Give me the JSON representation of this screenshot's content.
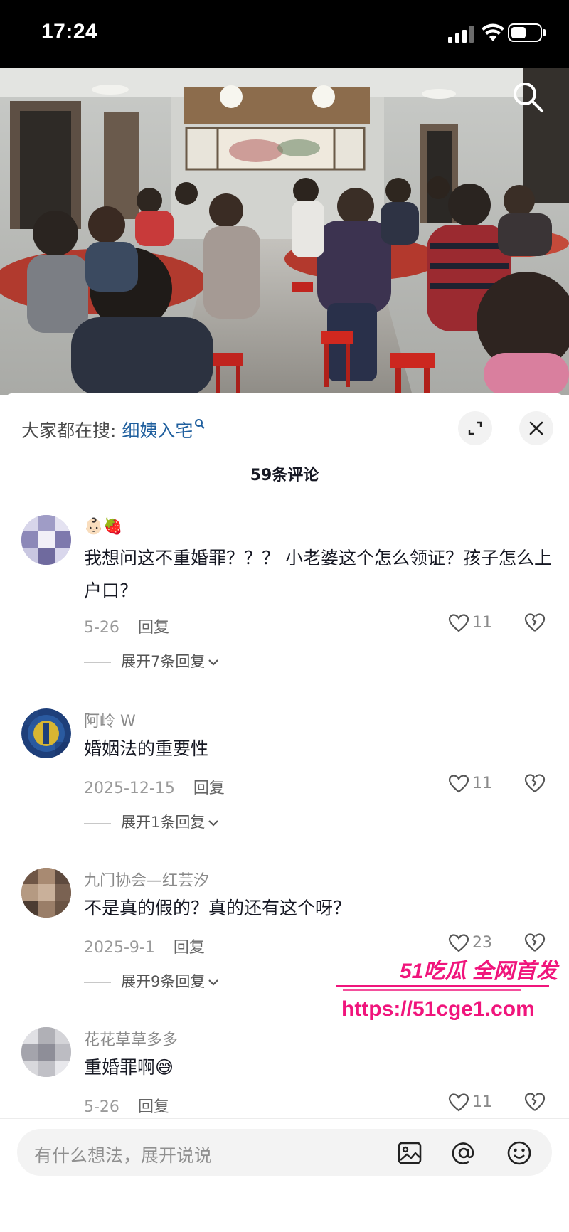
{
  "status_bar": {
    "time": "17:24"
  },
  "search_hint": {
    "label": "大家都在搜:",
    "term": "细姨入宅"
  },
  "comment_count": "59条评论",
  "comments": [
    {
      "username": "",
      "text": "我想问这不重婚罪？？？ 小老婆这个怎么领证？孩子怎么上户口？",
      "date": "5-26",
      "reply_label": "回复",
      "likes": "11",
      "expand_label": "展开7条回复"
    },
    {
      "username": "阿岭 W",
      "text": "婚姻法的重要性",
      "date": "2025-12-15",
      "reply_label": "回复",
      "likes": "11",
      "expand_label": "展开1条回复"
    },
    {
      "username": "九门协会—红芸汐",
      "text": "不是真的假的？真的还有这个呀？",
      "date": "2025-9-1",
      "reply_label": "回复",
      "likes": "23",
      "expand_label": "展开9条回复"
    },
    {
      "username": "花花草草多多",
      "text": "重婚罪啊😅",
      "date": "5-26",
      "reply_label": "回复",
      "likes": "11"
    }
  ],
  "watermark": {
    "brand": "51吃瓜 全网首发",
    "url": "https://51cge1.com"
  },
  "input_bar": {
    "placeholder": "有什么想法，展开说说"
  },
  "icons": {
    "search": "search-icon",
    "expand": "expand-icon",
    "close": "close-icon",
    "like": "heart-icon",
    "dislike": "broken-heart-icon",
    "image": "image-icon",
    "mention": "at-icon",
    "emoji": "emoji-icon"
  },
  "colors": {
    "link": "#1f5f9e",
    "watermark": "#f0157c",
    "sheet_bg": "#ffffff"
  }
}
